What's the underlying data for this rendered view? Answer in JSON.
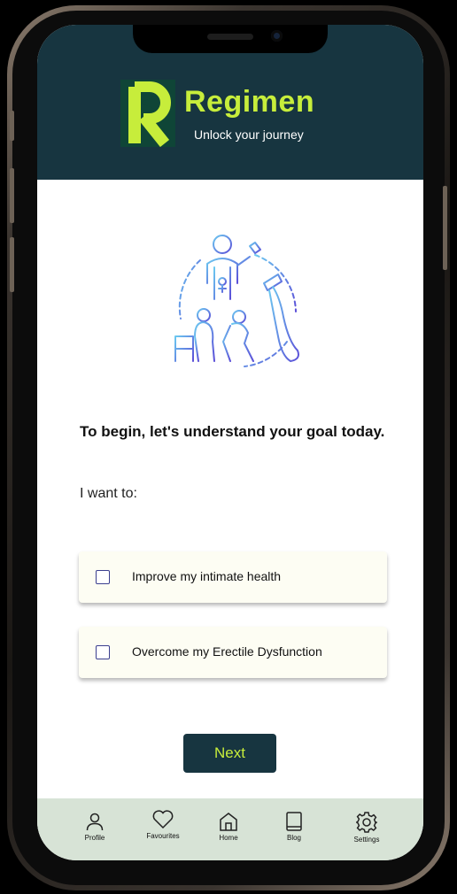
{
  "header": {
    "brand_name": "Regimen",
    "tagline": "Unlock your journey",
    "background_color": "#173540",
    "accent_color": "#c7ed3b"
  },
  "content": {
    "illustration_icon": "family-health-illustration",
    "question": "To begin, let's understand your goal today.",
    "prompt": "I want to:",
    "options": [
      {
        "label": "Improve my intimate health",
        "checked": false
      },
      {
        "label": "Overcome my Erectile Dysfunction",
        "checked": false
      }
    ],
    "next_label": "Next"
  },
  "bottom_nav": {
    "items": [
      {
        "label": "Profile",
        "icon": "person-icon"
      },
      {
        "label": "Favourites",
        "icon": "heart-icon"
      },
      {
        "label": "Home",
        "icon": "home-icon"
      },
      {
        "label": "Blog",
        "icon": "book-icon"
      },
      {
        "label": "Settings",
        "icon": "gear-icon"
      }
    ],
    "background_color": "#d7e3d6"
  }
}
